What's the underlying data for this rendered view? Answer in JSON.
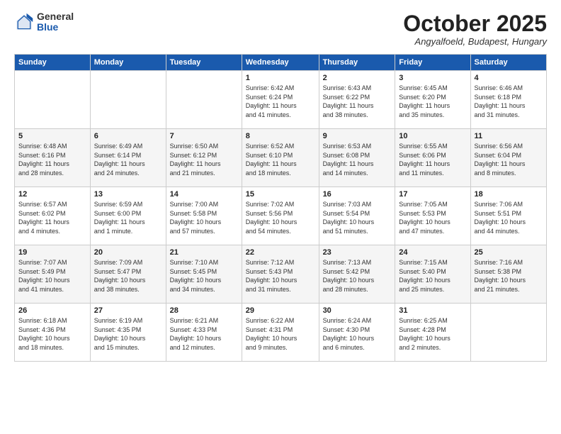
{
  "logo": {
    "general": "General",
    "blue": "Blue"
  },
  "header": {
    "month": "October 2025",
    "location": "Angyalfoeld, Budapest, Hungary"
  },
  "days_of_week": [
    "Sunday",
    "Monday",
    "Tuesday",
    "Wednesday",
    "Thursday",
    "Friday",
    "Saturday"
  ],
  "weeks": [
    [
      {
        "day": "",
        "info": ""
      },
      {
        "day": "",
        "info": ""
      },
      {
        "day": "",
        "info": ""
      },
      {
        "day": "1",
        "info": "Sunrise: 6:42 AM\nSunset: 6:24 PM\nDaylight: 11 hours\nand 41 minutes."
      },
      {
        "day": "2",
        "info": "Sunrise: 6:43 AM\nSunset: 6:22 PM\nDaylight: 11 hours\nand 38 minutes."
      },
      {
        "day": "3",
        "info": "Sunrise: 6:45 AM\nSunset: 6:20 PM\nDaylight: 11 hours\nand 35 minutes."
      },
      {
        "day": "4",
        "info": "Sunrise: 6:46 AM\nSunset: 6:18 PM\nDaylight: 11 hours\nand 31 minutes."
      }
    ],
    [
      {
        "day": "5",
        "info": "Sunrise: 6:48 AM\nSunset: 6:16 PM\nDaylight: 11 hours\nand 28 minutes."
      },
      {
        "day": "6",
        "info": "Sunrise: 6:49 AM\nSunset: 6:14 PM\nDaylight: 11 hours\nand 24 minutes."
      },
      {
        "day": "7",
        "info": "Sunrise: 6:50 AM\nSunset: 6:12 PM\nDaylight: 11 hours\nand 21 minutes."
      },
      {
        "day": "8",
        "info": "Sunrise: 6:52 AM\nSunset: 6:10 PM\nDaylight: 11 hours\nand 18 minutes."
      },
      {
        "day": "9",
        "info": "Sunrise: 6:53 AM\nSunset: 6:08 PM\nDaylight: 11 hours\nand 14 minutes."
      },
      {
        "day": "10",
        "info": "Sunrise: 6:55 AM\nSunset: 6:06 PM\nDaylight: 11 hours\nand 11 minutes."
      },
      {
        "day": "11",
        "info": "Sunrise: 6:56 AM\nSunset: 6:04 PM\nDaylight: 11 hours\nand 8 minutes."
      }
    ],
    [
      {
        "day": "12",
        "info": "Sunrise: 6:57 AM\nSunset: 6:02 PM\nDaylight: 11 hours\nand 4 minutes."
      },
      {
        "day": "13",
        "info": "Sunrise: 6:59 AM\nSunset: 6:00 PM\nDaylight: 11 hours\nand 1 minute."
      },
      {
        "day": "14",
        "info": "Sunrise: 7:00 AM\nSunset: 5:58 PM\nDaylight: 10 hours\nand 57 minutes."
      },
      {
        "day": "15",
        "info": "Sunrise: 7:02 AM\nSunset: 5:56 PM\nDaylight: 10 hours\nand 54 minutes."
      },
      {
        "day": "16",
        "info": "Sunrise: 7:03 AM\nSunset: 5:54 PM\nDaylight: 10 hours\nand 51 minutes."
      },
      {
        "day": "17",
        "info": "Sunrise: 7:05 AM\nSunset: 5:53 PM\nDaylight: 10 hours\nand 47 minutes."
      },
      {
        "day": "18",
        "info": "Sunrise: 7:06 AM\nSunset: 5:51 PM\nDaylight: 10 hours\nand 44 minutes."
      }
    ],
    [
      {
        "day": "19",
        "info": "Sunrise: 7:07 AM\nSunset: 5:49 PM\nDaylight: 10 hours\nand 41 minutes."
      },
      {
        "day": "20",
        "info": "Sunrise: 7:09 AM\nSunset: 5:47 PM\nDaylight: 10 hours\nand 38 minutes."
      },
      {
        "day": "21",
        "info": "Sunrise: 7:10 AM\nSunset: 5:45 PM\nDaylight: 10 hours\nand 34 minutes."
      },
      {
        "day": "22",
        "info": "Sunrise: 7:12 AM\nSunset: 5:43 PM\nDaylight: 10 hours\nand 31 minutes."
      },
      {
        "day": "23",
        "info": "Sunrise: 7:13 AM\nSunset: 5:42 PM\nDaylight: 10 hours\nand 28 minutes."
      },
      {
        "day": "24",
        "info": "Sunrise: 7:15 AM\nSunset: 5:40 PM\nDaylight: 10 hours\nand 25 minutes."
      },
      {
        "day": "25",
        "info": "Sunrise: 7:16 AM\nSunset: 5:38 PM\nDaylight: 10 hours\nand 21 minutes."
      }
    ],
    [
      {
        "day": "26",
        "info": "Sunrise: 6:18 AM\nSunset: 4:36 PM\nDaylight: 10 hours\nand 18 minutes."
      },
      {
        "day": "27",
        "info": "Sunrise: 6:19 AM\nSunset: 4:35 PM\nDaylight: 10 hours\nand 15 minutes."
      },
      {
        "day": "28",
        "info": "Sunrise: 6:21 AM\nSunset: 4:33 PM\nDaylight: 10 hours\nand 12 minutes."
      },
      {
        "day": "29",
        "info": "Sunrise: 6:22 AM\nSunset: 4:31 PM\nDaylight: 10 hours\nand 9 minutes."
      },
      {
        "day": "30",
        "info": "Sunrise: 6:24 AM\nSunset: 4:30 PM\nDaylight: 10 hours\nand 6 minutes."
      },
      {
        "day": "31",
        "info": "Sunrise: 6:25 AM\nSunset: 4:28 PM\nDaylight: 10 hours\nand 2 minutes."
      },
      {
        "day": "",
        "info": ""
      }
    ]
  ]
}
